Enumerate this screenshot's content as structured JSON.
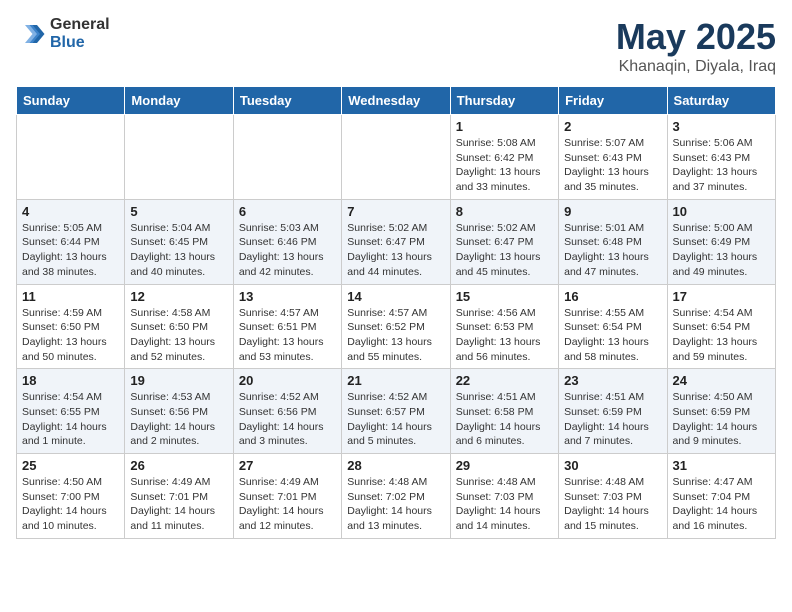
{
  "header": {
    "logo_general": "General",
    "logo_blue": "Blue",
    "month": "May 2025",
    "location": "Khanaqin, Diyala, Iraq"
  },
  "days_of_week": [
    "Sunday",
    "Monday",
    "Tuesday",
    "Wednesday",
    "Thursday",
    "Friday",
    "Saturday"
  ],
  "weeks": [
    [
      {
        "day": "",
        "info": ""
      },
      {
        "day": "",
        "info": ""
      },
      {
        "day": "",
        "info": ""
      },
      {
        "day": "",
        "info": ""
      },
      {
        "day": "1",
        "info": "Sunrise: 5:08 AM\nSunset: 6:42 PM\nDaylight: 13 hours\nand 33 minutes."
      },
      {
        "day": "2",
        "info": "Sunrise: 5:07 AM\nSunset: 6:43 PM\nDaylight: 13 hours\nand 35 minutes."
      },
      {
        "day": "3",
        "info": "Sunrise: 5:06 AM\nSunset: 6:43 PM\nDaylight: 13 hours\nand 37 minutes."
      }
    ],
    [
      {
        "day": "4",
        "info": "Sunrise: 5:05 AM\nSunset: 6:44 PM\nDaylight: 13 hours\nand 38 minutes."
      },
      {
        "day": "5",
        "info": "Sunrise: 5:04 AM\nSunset: 6:45 PM\nDaylight: 13 hours\nand 40 minutes."
      },
      {
        "day": "6",
        "info": "Sunrise: 5:03 AM\nSunset: 6:46 PM\nDaylight: 13 hours\nand 42 minutes."
      },
      {
        "day": "7",
        "info": "Sunrise: 5:02 AM\nSunset: 6:47 PM\nDaylight: 13 hours\nand 44 minutes."
      },
      {
        "day": "8",
        "info": "Sunrise: 5:02 AM\nSunset: 6:47 PM\nDaylight: 13 hours\nand 45 minutes."
      },
      {
        "day": "9",
        "info": "Sunrise: 5:01 AM\nSunset: 6:48 PM\nDaylight: 13 hours\nand 47 minutes."
      },
      {
        "day": "10",
        "info": "Sunrise: 5:00 AM\nSunset: 6:49 PM\nDaylight: 13 hours\nand 49 minutes."
      }
    ],
    [
      {
        "day": "11",
        "info": "Sunrise: 4:59 AM\nSunset: 6:50 PM\nDaylight: 13 hours\nand 50 minutes."
      },
      {
        "day": "12",
        "info": "Sunrise: 4:58 AM\nSunset: 6:50 PM\nDaylight: 13 hours\nand 52 minutes."
      },
      {
        "day": "13",
        "info": "Sunrise: 4:57 AM\nSunset: 6:51 PM\nDaylight: 13 hours\nand 53 minutes."
      },
      {
        "day": "14",
        "info": "Sunrise: 4:57 AM\nSunset: 6:52 PM\nDaylight: 13 hours\nand 55 minutes."
      },
      {
        "day": "15",
        "info": "Sunrise: 4:56 AM\nSunset: 6:53 PM\nDaylight: 13 hours\nand 56 minutes."
      },
      {
        "day": "16",
        "info": "Sunrise: 4:55 AM\nSunset: 6:54 PM\nDaylight: 13 hours\nand 58 minutes."
      },
      {
        "day": "17",
        "info": "Sunrise: 4:54 AM\nSunset: 6:54 PM\nDaylight: 13 hours\nand 59 minutes."
      }
    ],
    [
      {
        "day": "18",
        "info": "Sunrise: 4:54 AM\nSunset: 6:55 PM\nDaylight: 14 hours\nand 1 minute."
      },
      {
        "day": "19",
        "info": "Sunrise: 4:53 AM\nSunset: 6:56 PM\nDaylight: 14 hours\nand 2 minutes."
      },
      {
        "day": "20",
        "info": "Sunrise: 4:52 AM\nSunset: 6:56 PM\nDaylight: 14 hours\nand 3 minutes."
      },
      {
        "day": "21",
        "info": "Sunrise: 4:52 AM\nSunset: 6:57 PM\nDaylight: 14 hours\nand 5 minutes."
      },
      {
        "day": "22",
        "info": "Sunrise: 4:51 AM\nSunset: 6:58 PM\nDaylight: 14 hours\nand 6 minutes."
      },
      {
        "day": "23",
        "info": "Sunrise: 4:51 AM\nSunset: 6:59 PM\nDaylight: 14 hours\nand 7 minutes."
      },
      {
        "day": "24",
        "info": "Sunrise: 4:50 AM\nSunset: 6:59 PM\nDaylight: 14 hours\nand 9 minutes."
      }
    ],
    [
      {
        "day": "25",
        "info": "Sunrise: 4:50 AM\nSunset: 7:00 PM\nDaylight: 14 hours\nand 10 minutes."
      },
      {
        "day": "26",
        "info": "Sunrise: 4:49 AM\nSunset: 7:01 PM\nDaylight: 14 hours\nand 11 minutes."
      },
      {
        "day": "27",
        "info": "Sunrise: 4:49 AM\nSunset: 7:01 PM\nDaylight: 14 hours\nand 12 minutes."
      },
      {
        "day": "28",
        "info": "Sunrise: 4:48 AM\nSunset: 7:02 PM\nDaylight: 14 hours\nand 13 minutes."
      },
      {
        "day": "29",
        "info": "Sunrise: 4:48 AM\nSunset: 7:03 PM\nDaylight: 14 hours\nand 14 minutes."
      },
      {
        "day": "30",
        "info": "Sunrise: 4:48 AM\nSunset: 7:03 PM\nDaylight: 14 hours\nand 15 minutes."
      },
      {
        "day": "31",
        "info": "Sunrise: 4:47 AM\nSunset: 7:04 PM\nDaylight: 14 hours\nand 16 minutes."
      }
    ]
  ]
}
